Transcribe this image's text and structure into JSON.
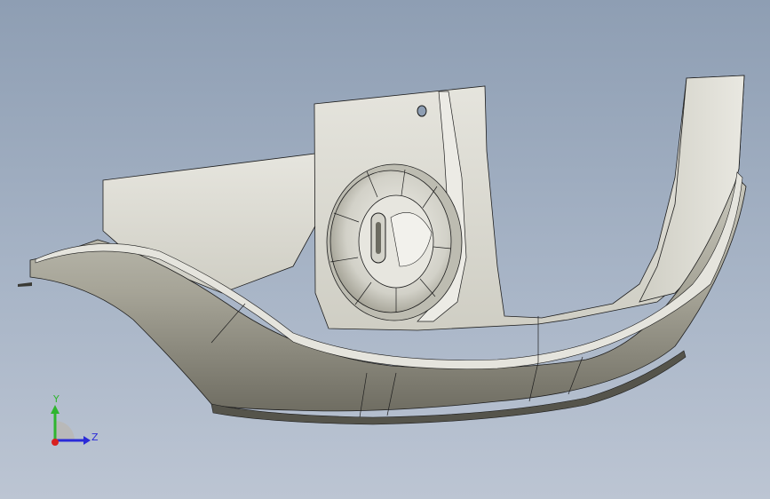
{
  "viewport": {
    "background_top": "#8e9eb3",
    "background_bottom": "#bcc5d3"
  },
  "model": {
    "surface_color": "#d9d8cf",
    "shadow_color": "#8c8a7d",
    "edge_color": "#1e1e1e"
  },
  "triad": {
    "y_label": "Y",
    "z_label": "Z",
    "y_color": "#2fb52f",
    "z_color": "#2a2ad8",
    "x_color": "#d82020"
  }
}
